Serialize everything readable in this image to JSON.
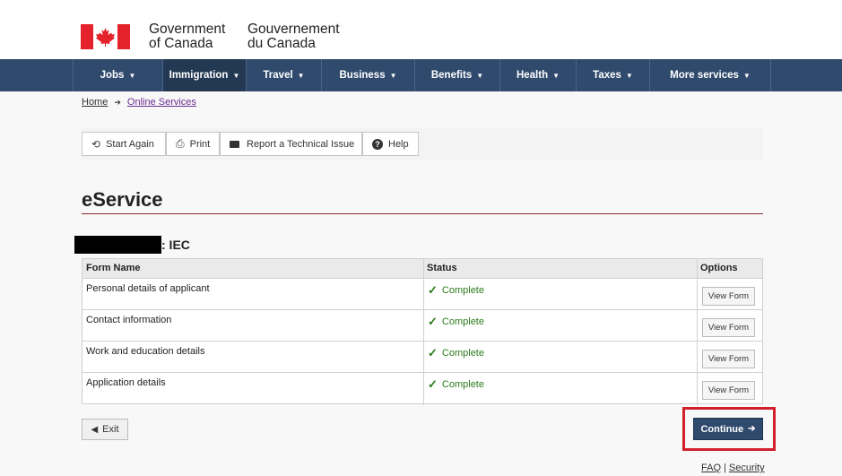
{
  "header": {
    "wordmark_en": [
      "Government",
      "of Canada"
    ],
    "wordmark_fr": [
      "Gouvernement",
      "du Canada"
    ],
    "flag_colors": {
      "red": "#e4222b",
      "white": "#ffffff"
    }
  },
  "nav": {
    "items": [
      {
        "label": "Jobs",
        "active": false
      },
      {
        "label": "Immigration",
        "active": true
      },
      {
        "label": "Travel",
        "active": false
      },
      {
        "label": "Business",
        "active": false
      },
      {
        "label": "Benefits",
        "active": false
      },
      {
        "label": "Health",
        "active": false
      },
      {
        "label": "Taxes",
        "active": false
      },
      {
        "label": "More services",
        "active": false
      }
    ],
    "background": "#2f4a6d"
  },
  "breadcrumb": {
    "home": "Home",
    "current": "Online Services"
  },
  "toolbar": {
    "start_again": "Start Again",
    "print": "Print",
    "report": "Report a Technical Issue",
    "help": "Help"
  },
  "page_title": "eService",
  "subheading": ": IEC",
  "table": {
    "headers": [
      "Form Name",
      "Status",
      "Options"
    ],
    "rows": [
      {
        "name": "Personal details of applicant",
        "status": "Complete",
        "action": "View Form"
      },
      {
        "name": "Contact information",
        "status": "Complete",
        "action": "View Form"
      },
      {
        "name": "Work and education details",
        "status": "Complete",
        "action": "View Form"
      },
      {
        "name": "Application details",
        "status": "Complete",
        "action": "View Form"
      }
    ]
  },
  "actions": {
    "exit": "Exit",
    "continue": "Continue"
  },
  "footer": {
    "faq": "FAQ",
    "separator": "|",
    "security": "Security"
  }
}
